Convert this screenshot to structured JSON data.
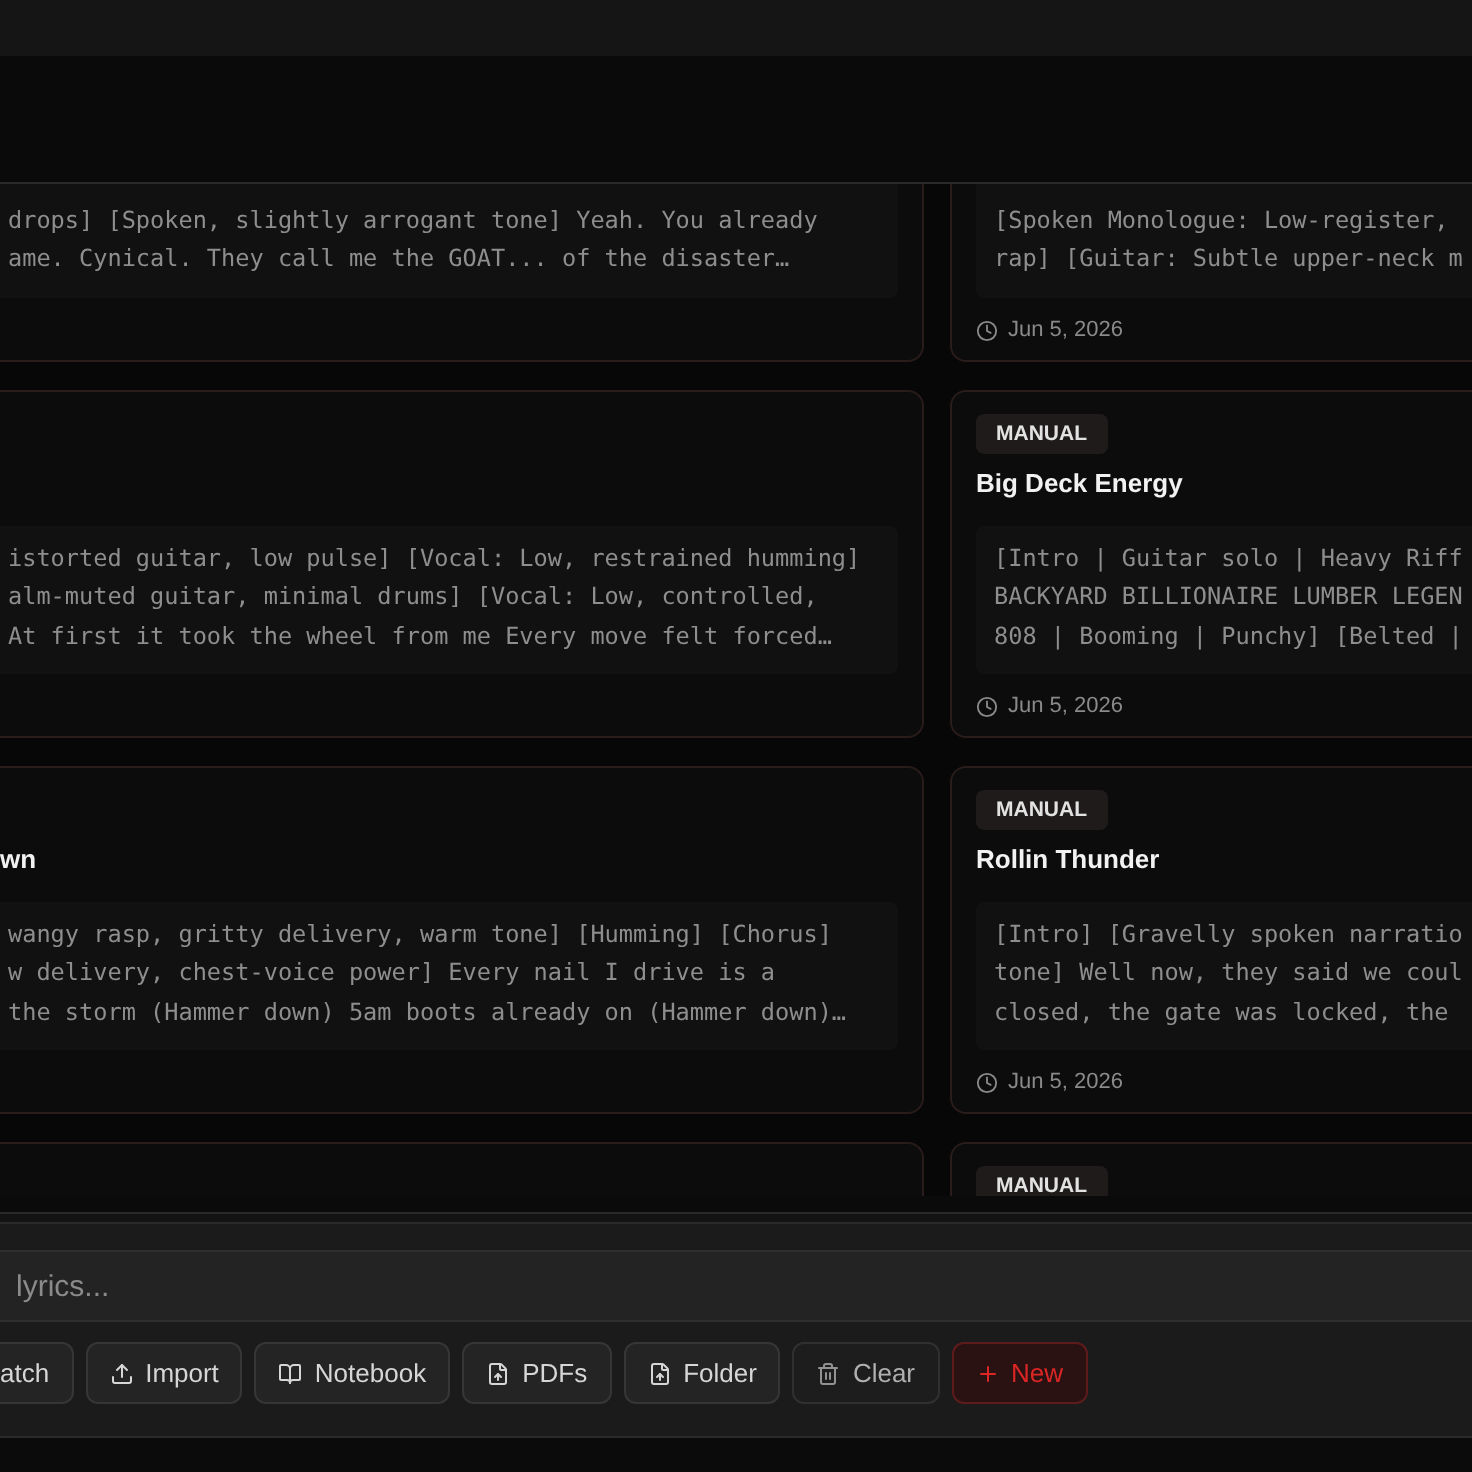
{
  "card_rows": [
    {
      "left": {
        "lyrics_lines": [
          "drops] [Spoken, slightly arrogant tone] Yeah. You already",
          "ame. Cynical. They call me the GOAT... of the disaster…"
        ]
      },
      "right": {
        "lyrics_lines": [
          "[Spoken Monologue: Low-register,",
          "rap] [Guitar: Subtle upper-neck m"
        ],
        "date": "Jun 5, 2026"
      }
    },
    {
      "left": {
        "lyrics_lines": [
          "istorted guitar, low pulse] [Vocal: Low, restrained humming]",
          "alm-muted guitar, minimal drums] [Vocal: Low, controlled,",
          "At first it took the wheel from me Every move felt forced…"
        ]
      },
      "right": {
        "badge": "MANUAL",
        "title": "Big Deck Energy",
        "lyrics_lines": [
          "[Intro | Guitar solo | Heavy Riff",
          "BACKYARD BILLIONAIRE LUMBER LEGEN",
          "808 | Booming | Punchy] [Belted |"
        ],
        "date": "Jun 5, 2026"
      }
    },
    {
      "left": {
        "title": "wn",
        "lyrics_lines": [
          "wangy rasp, gritty delivery, warm tone] [Humming] [Chorus]",
          "w delivery, chest-voice power] Every nail I drive is a",
          "the storm (Hammer down) 5am boots already on (Hammer down)…"
        ]
      },
      "right": {
        "badge": "MANUAL",
        "title": "Rollin Thunder",
        "lyrics_lines": [
          "[Intro] [Gravelly spoken narratio",
          "tone] Well now, they said we coul",
          "closed, the gate was locked, the"
        ],
        "date": "Jun 5, 2026"
      }
    },
    {
      "right": {
        "badge": "MANUAL"
      }
    }
  ],
  "search": {
    "placeholder": "lyrics..."
  },
  "buttons": [
    {
      "label": "atch",
      "kind": "default",
      "disabled": false
    },
    {
      "label": "Import",
      "kind": "default",
      "disabled": false
    },
    {
      "label": "Notebook",
      "kind": "default",
      "disabled": false
    },
    {
      "label": "PDFs",
      "kind": "default",
      "disabled": false
    },
    {
      "label": "Folder",
      "kind": "default",
      "disabled": false
    },
    {
      "label": "Clear",
      "kind": "default",
      "disabled": true
    },
    {
      "label": "New",
      "kind": "danger",
      "disabled": false
    }
  ]
}
